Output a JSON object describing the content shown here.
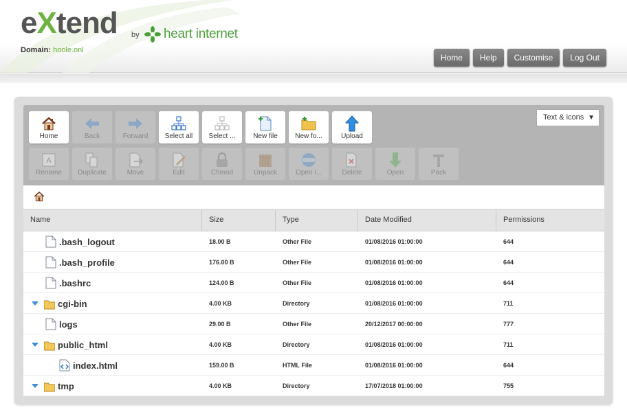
{
  "header": {
    "logo_prefix": "e",
    "logo_x": "X",
    "logo_suffix": "tend",
    "by": "by",
    "partner": "heart internet",
    "domain_label": "Domain:",
    "domain_value": "hoole.onl"
  },
  "topnav": [
    "Home",
    "Help",
    "Customise",
    "Log Out"
  ],
  "toolbar": {
    "row1": [
      {
        "label": "Home",
        "icon": "home-icon",
        "enabled": true
      },
      {
        "label": "Back",
        "icon": "back-arrow-icon",
        "enabled": false
      },
      {
        "label": "Forward",
        "icon": "forward-arrow-icon",
        "enabled": false
      },
      {
        "label": "Select all",
        "icon": "select-all-icon",
        "enabled": true
      },
      {
        "label": "Select ...",
        "icon": "select-none-icon",
        "enabled": true
      },
      {
        "label": "New file",
        "icon": "new-file-icon",
        "enabled": true
      },
      {
        "label": "New fo...",
        "icon": "new-folder-icon",
        "enabled": true
      },
      {
        "label": "Upload",
        "icon": "upload-icon",
        "enabled": true
      }
    ],
    "row2": [
      {
        "label": "Rename",
        "icon": "rename-icon",
        "enabled": false
      },
      {
        "label": "Duplicate",
        "icon": "duplicate-icon",
        "enabled": false
      },
      {
        "label": "Move",
        "icon": "move-icon",
        "enabled": false
      },
      {
        "label": "Edit",
        "icon": "edit-icon",
        "enabled": false
      },
      {
        "label": "Chmod",
        "icon": "chmod-lock-icon",
        "enabled": false
      },
      {
        "label": "Unpack",
        "icon": "unpack-icon",
        "enabled": false
      },
      {
        "label": "Open i...",
        "icon": "open-in-browser-icon",
        "enabled": false
      },
      {
        "label": "Delete",
        "icon": "delete-icon",
        "enabled": false
      },
      {
        "label": "Open",
        "icon": "open-download-icon",
        "enabled": false
      },
      {
        "label": "Pack",
        "icon": "pack-icon",
        "enabled": false
      }
    ]
  },
  "view_mode": "Text & icons",
  "table": {
    "columns": [
      "Name",
      "Size",
      "Type",
      "Date Modified",
      "Permissions"
    ],
    "rows": [
      {
        "name": ".bash_logout",
        "size": "18.00 B",
        "type": "Other File",
        "date": "01/08/2016 01:00:00",
        "perm": "644",
        "kind": "file",
        "depth": 0
      },
      {
        "name": ".bash_profile",
        "size": "176.00 B",
        "type": "Other File",
        "date": "01/08/2016 01:00:00",
        "perm": "644",
        "kind": "file",
        "depth": 0
      },
      {
        "name": ".bashrc",
        "size": "124.00 B",
        "type": "Other File",
        "date": "01/08/2016 01:00:00",
        "perm": "644",
        "kind": "file",
        "depth": 0
      },
      {
        "name": "cgi-bin",
        "size": "4.00 KB",
        "type": "Directory",
        "date": "01/08/2016 01:00:00",
        "perm": "711",
        "kind": "folder",
        "depth": 0
      },
      {
        "name": "logs",
        "size": "29.00 B",
        "type": "Other File",
        "date": "20/12/2017 00:00:00",
        "perm": "777",
        "kind": "file",
        "depth": 0
      },
      {
        "name": "public_html",
        "size": "4.00 KB",
        "type": "Directory",
        "date": "01/08/2016 01:00:00",
        "perm": "711",
        "kind": "folder",
        "depth": 0
      },
      {
        "name": "index.html",
        "size": "159.00 B",
        "type": "HTML File",
        "date": "01/08/2016 01:00:00",
        "perm": "644",
        "kind": "html",
        "depth": 1
      },
      {
        "name": "tmp",
        "size": "4.00 KB",
        "type": "Directory",
        "date": "17/07/2018 01:00:00",
        "perm": "755",
        "kind": "folder",
        "depth": 0
      }
    ]
  },
  "colors": {
    "brand_green": "#6cb33f",
    "button_gray": "#777777"
  }
}
